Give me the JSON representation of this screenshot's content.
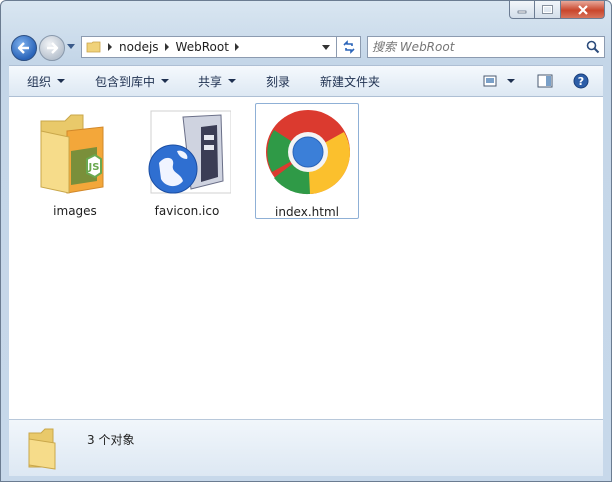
{
  "window": {
    "buttons": {
      "minimize": "minimize-icon",
      "maximize": "maximize-icon",
      "close": "close-icon"
    }
  },
  "address": {
    "segments": [
      "nodejs",
      "WebRoot"
    ],
    "search_placeholder": "搜索 WebRoot"
  },
  "toolbar": {
    "organize": "组织",
    "include_in_library": "包含到库中",
    "share": "共享",
    "burn": "刻录",
    "new_folder": "新建文件夹"
  },
  "files": [
    {
      "name": "images",
      "icon": "folder-icon"
    },
    {
      "name": "favicon.ico",
      "icon": "server-globe-icon"
    },
    {
      "name": "index.html",
      "icon": "chrome-icon",
      "selected": true
    }
  ],
  "status": {
    "item_count": "3 个对象"
  },
  "colors": {
    "accent": "#2a64b9",
    "toolbar_text": "#1e3050",
    "close": "#c9462c"
  }
}
